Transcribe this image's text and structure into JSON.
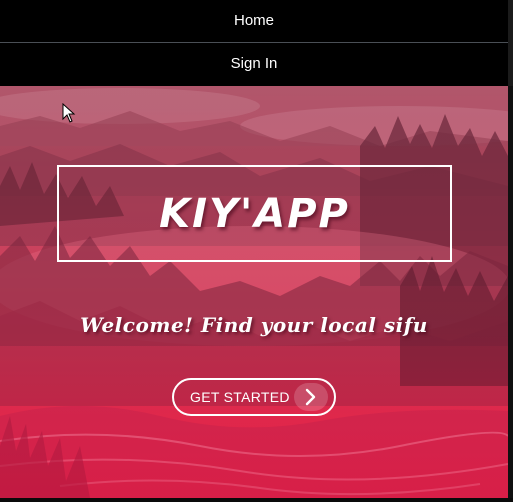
{
  "nav": {
    "home_label": "Home",
    "signin_label": "Sign In"
  },
  "hero": {
    "title": "KIY'APP",
    "tagline": "Welcome! Find your local sifu",
    "cta_label": "GET STARTED",
    "cta_icon": "chevron-right-icon"
  },
  "colors": {
    "nav_background": "#000000",
    "nav_text": "#ffffff",
    "hero_accent": "#e22747",
    "text_on_hero": "#ffffff"
  }
}
